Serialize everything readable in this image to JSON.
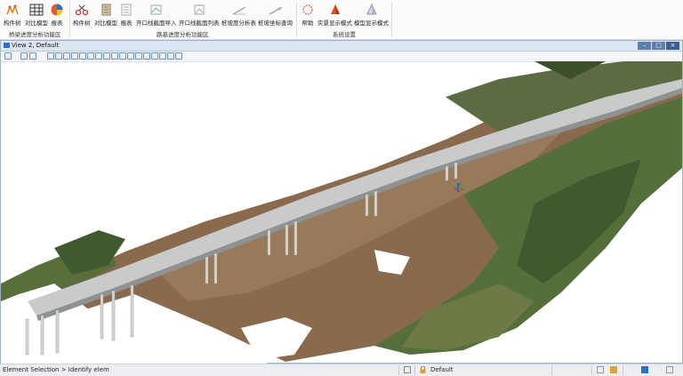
{
  "ribbon": {
    "groups": [
      {
        "label": "桥梁进度分析功能区",
        "buttons": [
          {
            "label": "构件树",
            "icon": "structure-tree-icon"
          },
          {
            "label": "对比模型",
            "icon": "compare-model-icon"
          },
          {
            "label": "报表",
            "icon": "report-icon"
          }
        ]
      },
      {
        "label": "路基进度分析功能区",
        "buttons": [
          {
            "label": "构件树",
            "icon": "structure-tree-icon"
          },
          {
            "label": "对比模型",
            "icon": "compare-model-icon"
          },
          {
            "label": "报表",
            "icon": "report-icon"
          },
          {
            "label": "开口线截面导入",
            "icon": "section-import-icon"
          },
          {
            "label": "开口线截面列表",
            "icon": "section-list-icon"
          },
          {
            "label": "桩坡度分析表",
            "icon": "slope-analysis-icon"
          },
          {
            "label": "桩坡坐标查询",
            "icon": "coordinate-query-icon"
          }
        ]
      },
      {
        "label": "系统设置",
        "buttons": [
          {
            "label": "帮助",
            "icon": "help-icon"
          },
          {
            "label": "实景显示模式",
            "icon": "reality-mode-icon"
          },
          {
            "label": "模型显示模式",
            "icon": "model-mode-icon"
          }
        ]
      }
    ]
  },
  "view": {
    "title": "View 2, Default",
    "controls": {
      "minimize": "–",
      "restore": "□",
      "close": "×"
    }
  },
  "status": {
    "message": "Element Selection > Identify elem",
    "model": "Default"
  },
  "colors": {
    "ribbon_bg": "#fbfbfb",
    "view_title_bg": "#dbe6f2",
    "window_button": "#5b7fae",
    "bridge_deck": "#c9cbcb",
    "terrain_dirt": "#8a6a4d",
    "vegetation": "#4e6b3a"
  }
}
